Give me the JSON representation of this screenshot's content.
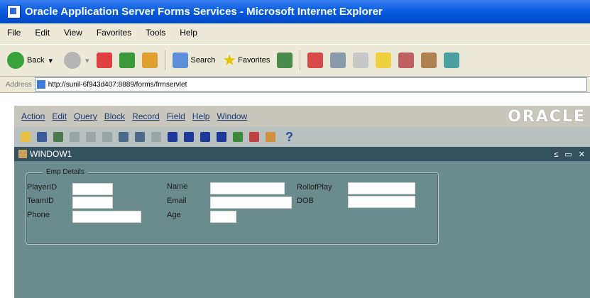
{
  "browser": {
    "title": "Oracle Application Server Forms Services - Microsoft Internet Explorer",
    "menu": [
      "File",
      "Edit",
      "View",
      "Favorites",
      "Tools",
      "Help"
    ],
    "toolbar": {
      "back": "Back",
      "search": "Search",
      "favorites": "Favorites"
    },
    "address_label": "Address",
    "url": "http://sunil-6f943d407:8889/forms/frmservlet"
  },
  "forms": {
    "menu": [
      "Action",
      "Edit",
      "Query",
      "Block",
      "Record",
      "Field",
      "Help",
      "Window"
    ],
    "brand": "ORACLE",
    "help_glyph": "?",
    "window_title": "WINDOW1",
    "window_controls": "≤ ▭ ✕",
    "frame_title": "Emp Details",
    "labels": {
      "playerid": "PlayerID",
      "teamid": "TeamID",
      "phone": "Phone",
      "name": "Name",
      "email": "Email",
      "age": "Age",
      "rollofplay": "RollofPlay",
      "dob": "DOB"
    }
  }
}
